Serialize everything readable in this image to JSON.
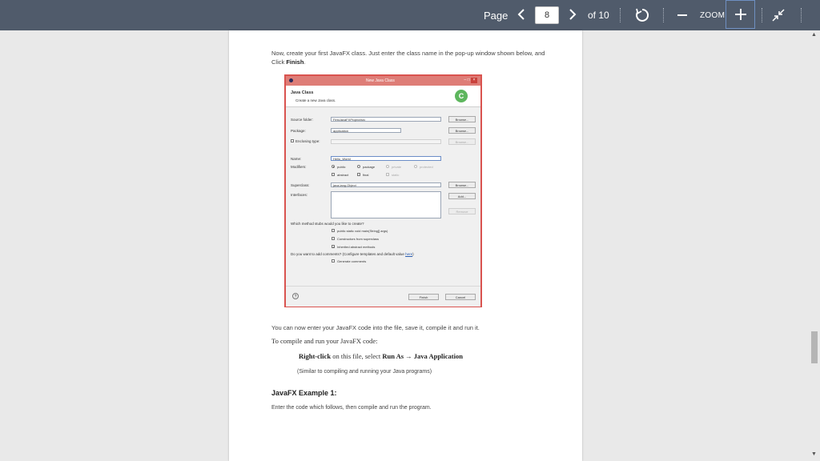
{
  "toolbar": {
    "page_label": "Page",
    "current_page": "8",
    "of_label": "of 10",
    "zoom_label": "ZOOM"
  },
  "document": {
    "intro_prefix": "Now, create your first JavaFX class. Just enter the class name in the pop-up window shown below, and Click ",
    "intro_bold": "Finish",
    "intro_suffix": ".",
    "after_dialog": "You can now enter your JavaFX code into the file, save it, compile it and run it.",
    "compile_line": "To compile and run your JavaFX code:",
    "instruction_prefix": "Right-click",
    "instruction_mid": " on this file, select ",
    "instruction_bold": "Run As → Java Application",
    "similar_note": "(Similar to compiling and running your Java programs)",
    "example_heading": "JavaFX Example 1:",
    "example_text": "Enter the code which follows, then compile and run the program."
  },
  "dialog": {
    "title": "New Java Class",
    "header_title": "Java Class",
    "header_subtitle": "Create a new Java class.",
    "source_folder_label": "Source folder:",
    "source_folder_value": "FirstJavaFXProject/src",
    "package_label": "Package:",
    "package_value": "application",
    "enclosing_label": "Enclosing type:",
    "name_label": "Name:",
    "name_value": "Hello_World",
    "modifiers_label": "Modifiers:",
    "mod_public": "public",
    "mod_package": "package",
    "mod_private": "private",
    "mod_protected": "protected",
    "mod_abstract": "abstract",
    "mod_final": "final",
    "mod_static": "static",
    "superclass_label": "Superclass:",
    "superclass_value": "java.lang.Object",
    "interfaces_label": "Interfaces:",
    "browse": "Browse...",
    "add": "Add...",
    "remove": "Remove",
    "stubs_question": "Which method stubs would you like to create?",
    "stub_main": "public static void main(String[] args)",
    "stub_constructors": "Constructors from superclass",
    "stub_inherited": "Inherited abstract methods",
    "comments_question": "Do you want to add comments? (Configure templates and default value ",
    "comments_link": "here",
    "comments_close": ")",
    "generate_comments": "Generate comments",
    "finish": "Finish",
    "cancel": "Cancel",
    "help": "?",
    "close": "×",
    "minmax": "– □"
  }
}
